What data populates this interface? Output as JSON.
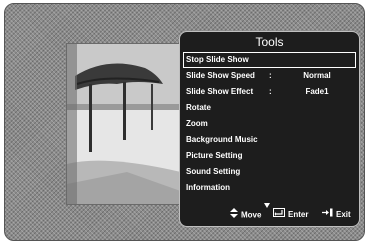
{
  "tools": {
    "title": "Tools",
    "items": [
      {
        "label": "Stop Slide Show",
        "value": ""
      },
      {
        "label": "Slide Show Speed",
        "value": "Normal"
      },
      {
        "label": "Slide Show Effect",
        "value": "Fade1"
      },
      {
        "label": "Rotate",
        "value": ""
      },
      {
        "label": "Zoom",
        "value": ""
      },
      {
        "label": "Background Music",
        "value": ""
      },
      {
        "label": "Picture Setting",
        "value": ""
      },
      {
        "label": "Sound Setting",
        "value": ""
      },
      {
        "label": "Information",
        "value": ""
      }
    ],
    "separator": ":"
  },
  "footer": {
    "move": "Move",
    "enter": "Enter",
    "exit": "Exit"
  },
  "icons": {
    "move": "up-down-arrows-icon",
    "enter": "enter-icon",
    "exit": "exit-icon",
    "more": "down-arrow-icon"
  },
  "colors": {
    "panel": "#1d1d1d",
    "text": "#ffffff",
    "screen": "#8c8c8c"
  }
}
